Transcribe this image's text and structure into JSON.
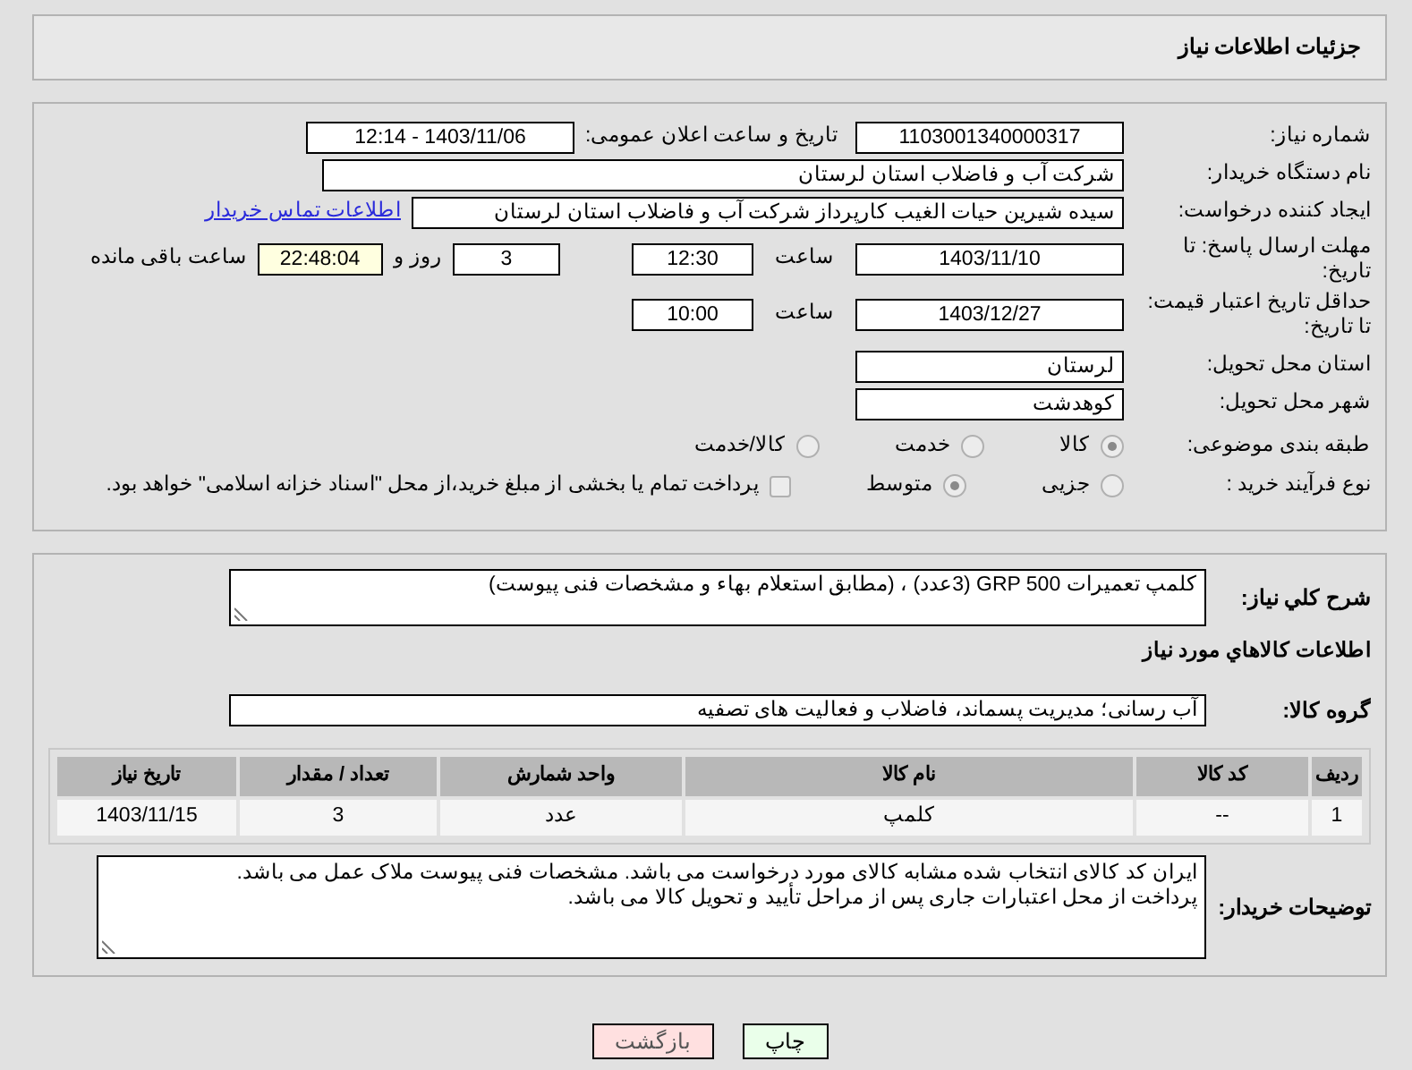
{
  "header": {
    "title": "جزئیات اطلاعات نیاز"
  },
  "need_number": {
    "label": "شماره نیاز:",
    "value": "1103001340000317"
  },
  "announce": {
    "label": "تاریخ و ساعت اعلان عمومی:",
    "value": "1403/11/06 - 12:14"
  },
  "buyer_org": {
    "label": "نام دستگاه خریدار:",
    "value": "شرکت آب و فاضلاب استان لرستان"
  },
  "requester": {
    "label": "ایجاد کننده درخواست:",
    "value": "سیده شیرین حیات الغیب کارپرداز شرکت آب و فاضلاب استان لرستان",
    "link": "اطلاعات تماس خریدار"
  },
  "deadline": {
    "label": "مهلت ارسال پاسخ: تا تاریخ:",
    "date": "1403/11/10",
    "time_label": "ساعت",
    "time": "12:30",
    "days": "3",
    "days_label": "روز و",
    "remaining": "22:48:04",
    "remaining_label": "ساعت باقی مانده"
  },
  "validity": {
    "label": "حداقل تاریخ اعتبار قیمت: تا تاریخ:",
    "date": "1403/12/27",
    "time_label": "ساعت",
    "time": "10:00"
  },
  "province": {
    "label": "استان محل تحویل:",
    "value": "لرستان"
  },
  "city": {
    "label": "شهر محل تحویل:",
    "value": "کوهدشت"
  },
  "category": {
    "label": "طبقه بندی موضوعی:",
    "options": [
      {
        "label": "کالا",
        "selected": true
      },
      {
        "label": "خدمت",
        "selected": false
      },
      {
        "label": "کالا/خدمت",
        "selected": false
      }
    ]
  },
  "process": {
    "label": "نوع فرآیند خرید :",
    "options": [
      {
        "label": "جزیی",
        "selected": false
      },
      {
        "label": "متوسط",
        "selected": true
      }
    ],
    "payment": {
      "checked": false,
      "text": "پرداخت تمام یا بخشی از مبلغ خرید،از محل \"اسناد خزانه اسلامی\" خواهد بود."
    }
  },
  "description": {
    "label": "شرح کلي نياز:",
    "value": "کلمپ تعمیرات GRP 500 (3عدد) ، (مطابق استعلام بهاء و مشخصات فنی پیوست)"
  },
  "goods_title": "اطلاعات کالاهاي مورد نياز",
  "goods_group": {
    "label": "گروه کالا:",
    "value": "آب رسانی؛ مدیریت پسماند، فاضلاب و فعالیت های تصفیه"
  },
  "table": {
    "columns": [
      "ردیف",
      "کد کالا",
      "نام کالا",
      "واحد شمارش",
      "تعداد / مقدار",
      "تاریخ نیاز"
    ],
    "rows": [
      [
        "1",
        "--",
        "کلمپ",
        "عدد",
        "3",
        "1403/11/15"
      ]
    ]
  },
  "buyer_notes": {
    "label": "توضیحات خریدار:",
    "lines": [
      "ایران کد کالای انتخاب شده مشابه کالای مورد درخواست می باشد. مشخصات فنی پیوست ملاک عمل می باشد.",
      "پرداخت از محل اعتبارات جاری پس از مراحل تأیید و تحویل کالا می باشد."
    ]
  },
  "buttons": [
    {
      "label": "چاپ",
      "kind": "print"
    },
    {
      "label": "بازگشت",
      "kind": "back"
    }
  ]
}
